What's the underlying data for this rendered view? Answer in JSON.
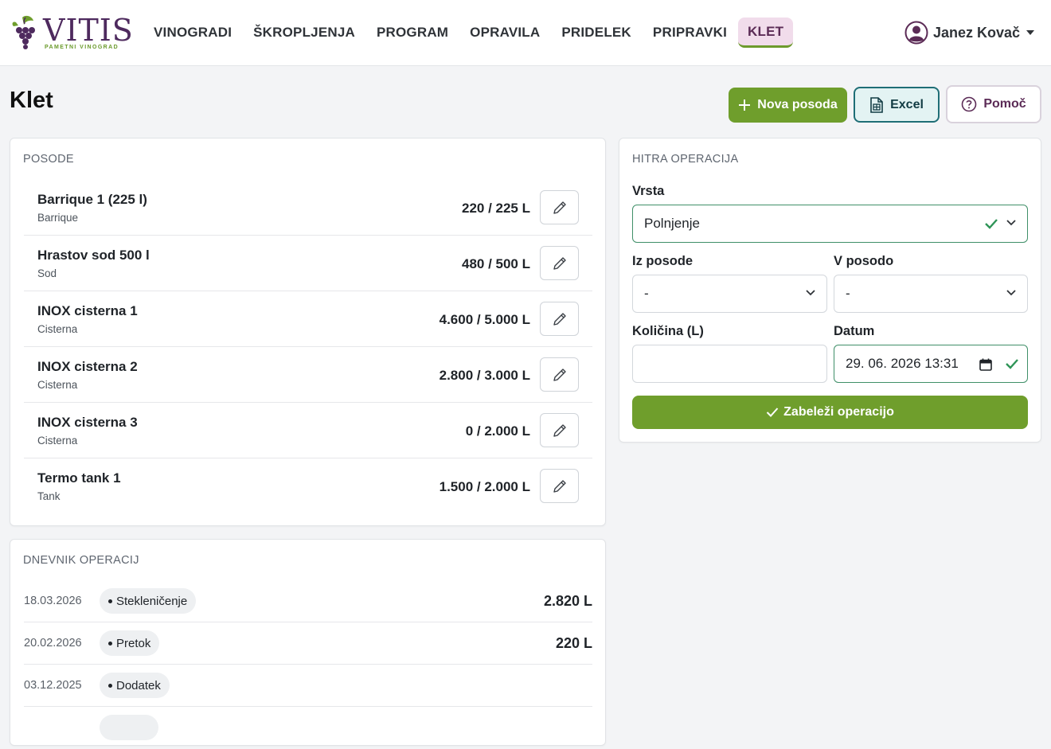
{
  "brand": {
    "name": "VITIS",
    "tagline": "PAMETNI VINOGRAD"
  },
  "nav": {
    "items": [
      "VINOGRADI",
      "ŠKROPLJENJA",
      "PROGRAM",
      "OPRAVILA",
      "PRIDELEK",
      "PRIPRAVKI",
      "KLET"
    ],
    "active": "KLET"
  },
  "user": {
    "name": "Janez Kovač"
  },
  "page": {
    "title": "Klet"
  },
  "actions": {
    "new_vessel": "Nova posoda",
    "excel": "Excel",
    "help": "Pomoč"
  },
  "vessels": {
    "title": "POSODE",
    "items": [
      {
        "name": "Barrique 1 (225 l)",
        "type": "Barrique",
        "amount": "220 / 225 L"
      },
      {
        "name": "Hrastov sod 500 l",
        "type": "Sod",
        "amount": "480 / 500 L"
      },
      {
        "name": "INOX cisterna 1",
        "type": "Cisterna",
        "amount": "4.600 / 5.000 L"
      },
      {
        "name": "INOX cisterna 2",
        "type": "Cisterna",
        "amount": "2.800 / 3.000 L"
      },
      {
        "name": "INOX cisterna 3",
        "type": "Cisterna",
        "amount": "0 / 2.000 L"
      },
      {
        "name": "Termo tank 1",
        "type": "Tank",
        "amount": "1.500 / 2.000 L"
      }
    ]
  },
  "quick_op": {
    "title": "HITRA OPERACIJA",
    "type_label": "Vrsta",
    "type_value": "Polnjenje",
    "from_label": "Iz posode",
    "from_value": "-",
    "to_label": "V posodo",
    "to_value": "-",
    "qty_label": "Količina (L)",
    "qty_value": "",
    "date_label": "Datum",
    "date_value": "29. 06. 2026 13:31",
    "submit": "Zabeleži operacijo"
  },
  "log": {
    "title": "DNEVNIK OPERACIJ",
    "items": [
      {
        "date": "18.03.2026",
        "op": "Stekleničenje",
        "amount": "2.820 L"
      },
      {
        "date": "20.02.2026",
        "op": "Pretok",
        "amount": "220 L"
      },
      {
        "date": "03.12.2025",
        "op": "Dodatek",
        "amount": ""
      }
    ]
  },
  "colors": {
    "primary_green": "#6f9e2c",
    "brand_purple": "#4e2a5e",
    "excel_teal": "#1f6e76",
    "valid": "#2e9457"
  }
}
